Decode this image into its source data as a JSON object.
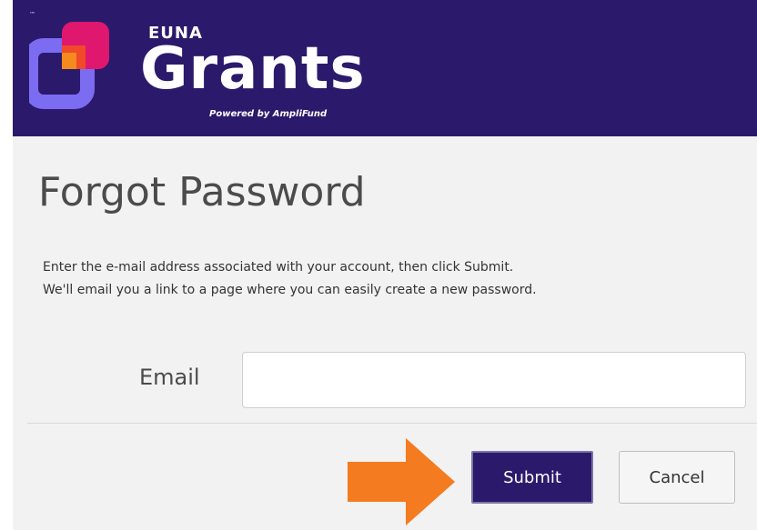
{
  "header": {
    "trademark": "™",
    "brand_small": "EUNA",
    "brand_large": "Grants",
    "tagline": "Powered by AmpliFund"
  },
  "page": {
    "title": "Forgot Password",
    "instructions": [
      "Enter the e-mail address associated with your account, then click Submit.",
      "We'll email you a link to a page where you can easily create a new password."
    ]
  },
  "form": {
    "email_label": "Email",
    "email_value": "",
    "submit_label": "Submit",
    "cancel_label": "Cancel"
  },
  "colors": {
    "header_bg": "#2b1a6b",
    "accent_arrow": "#f47b20",
    "submit_bg": "#2b1a6b"
  },
  "icons": [
    "euna-logo-icon",
    "arrow-right-icon"
  ]
}
